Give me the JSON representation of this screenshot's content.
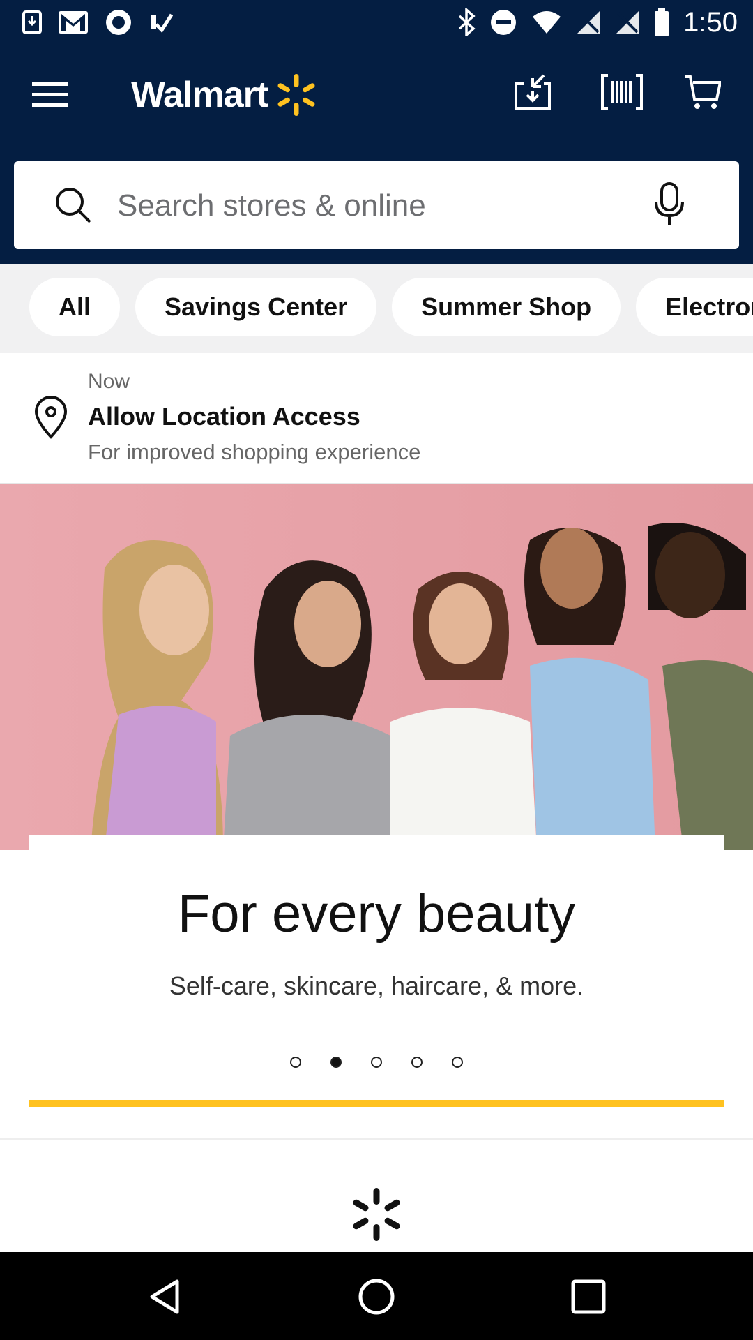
{
  "status_bar": {
    "time": "1:50",
    "left_icons": [
      "download-notification-icon",
      "gmail-icon",
      "record-icon",
      "check-icon"
    ],
    "right_icons": [
      "bluetooth-icon",
      "dnd-icon",
      "wifi-icon",
      "signal-off-icon",
      "signal-off-icon",
      "battery-icon"
    ]
  },
  "header": {
    "logo_text": "Walmart",
    "brand_yellow": "#ffc220",
    "brand_navy": "#041e42",
    "icons": [
      "menu-icon",
      "download-icon",
      "barcode-icon",
      "cart-icon"
    ]
  },
  "search": {
    "placeholder": "Search stores & online"
  },
  "chips": [
    {
      "label": "All"
    },
    {
      "label": "Savings Center"
    },
    {
      "label": "Summer Shop"
    },
    {
      "label": "Electronics"
    }
  ],
  "notification": {
    "time": "Now",
    "title": "Allow Location Access",
    "body": "For improved shopping experience"
  },
  "hero": {
    "title": "For every beauty",
    "subtitle": "Self-care, skincare, haircare, & more.",
    "carousel_total": 5,
    "carousel_active": 2
  }
}
